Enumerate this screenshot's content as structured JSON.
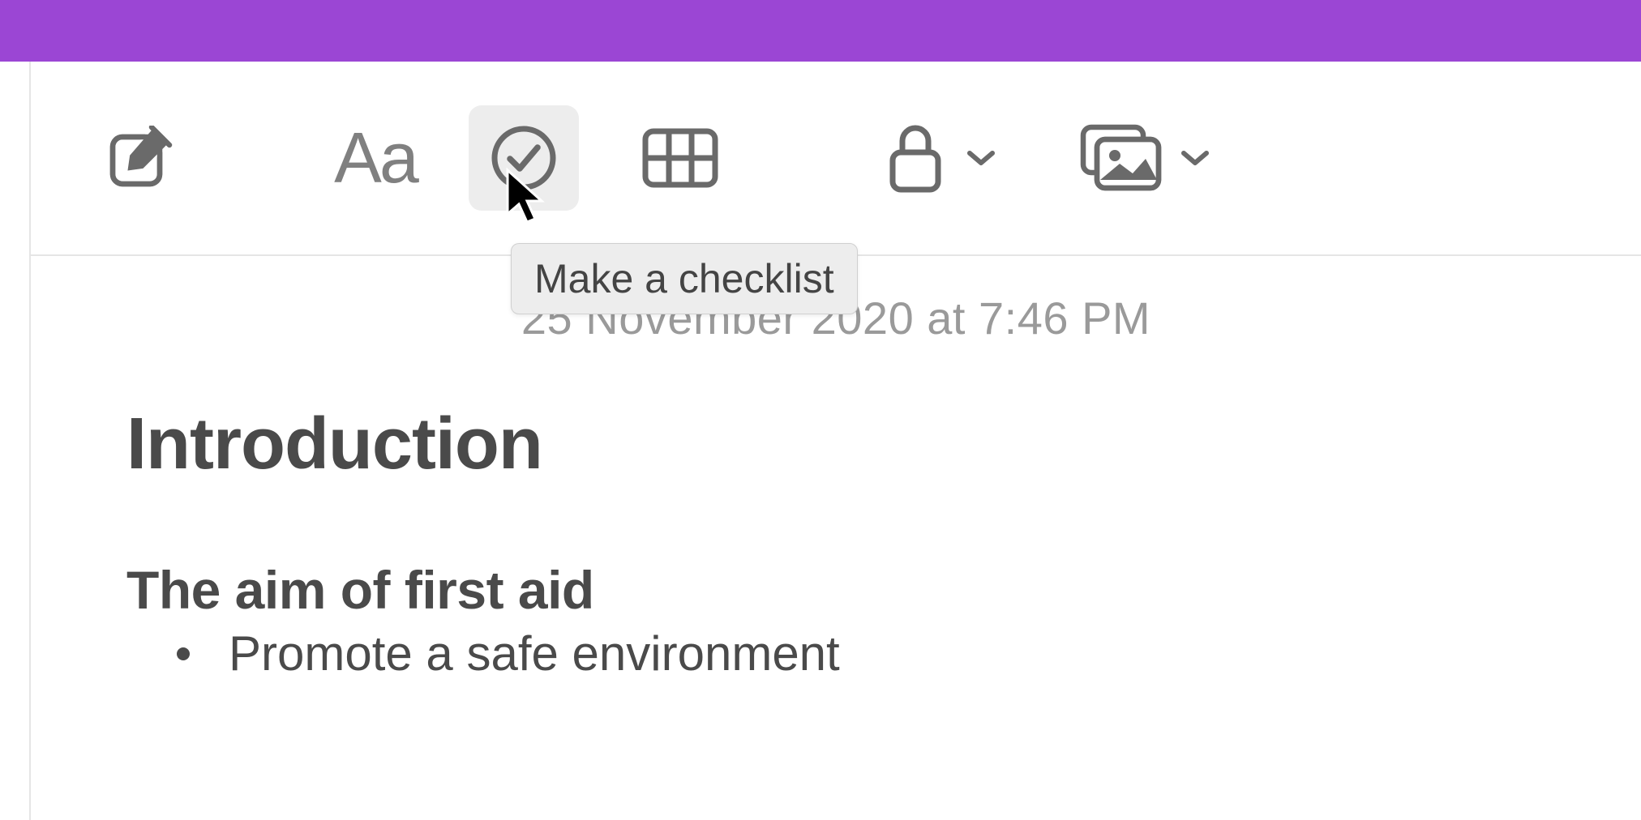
{
  "toolbar": {
    "format_label": "Aa",
    "tooltip": "Make a checklist"
  },
  "note": {
    "timestamp": "25 November 2020 at 7:46 PM",
    "title": "Introduction",
    "subtitle": "The aim of first aid",
    "bullets": [
      "Promote a safe environment"
    ]
  }
}
